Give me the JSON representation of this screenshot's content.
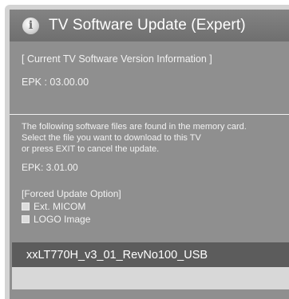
{
  "dialog": {
    "title": "TV Software Update (Expert)",
    "info_icon_glyph": "i"
  },
  "current": {
    "heading": "[ Current TV Software Version Information ]",
    "epk": "EPK : 03.00.00"
  },
  "found": {
    "line1": "The following software files are found in the memory card.",
    "line2": "Select the file you want to download to this TV",
    "line3": "or press EXIT to cancel the update.",
    "epk": "EPK: 3.01.00"
  },
  "forced_option": {
    "heading": "[Forced Update Option]",
    "options": [
      {
        "label": "Ext. MICOM",
        "checked": false
      },
      {
        "label": "LOGO Image",
        "checked": false
      }
    ]
  },
  "file_list": {
    "items": [
      "xxLT770H_v3_01_RevNo100_USB"
    ]
  },
  "colors": {
    "dialog_bg": "#8f8f8f",
    "title_bg": "#787878",
    "file_row_bg": "#5c5c5c",
    "frame_bg": "#d4d4d4"
  }
}
